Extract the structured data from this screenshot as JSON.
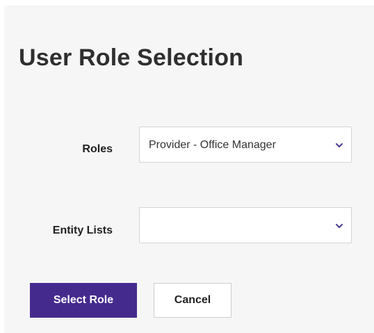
{
  "page": {
    "title": "User Role Selection"
  },
  "form": {
    "roles": {
      "label": "Roles",
      "selected": "Provider - Office Manager"
    },
    "entity_lists": {
      "label": "Entity Lists",
      "selected": ""
    }
  },
  "actions": {
    "select_role_label": "Select Role",
    "cancel_label": "Cancel"
  },
  "icons": {
    "dropdown": "chevron-down-icon"
  },
  "colors": {
    "primary": "#452a8e",
    "panel_background": "#f6f6f6"
  }
}
